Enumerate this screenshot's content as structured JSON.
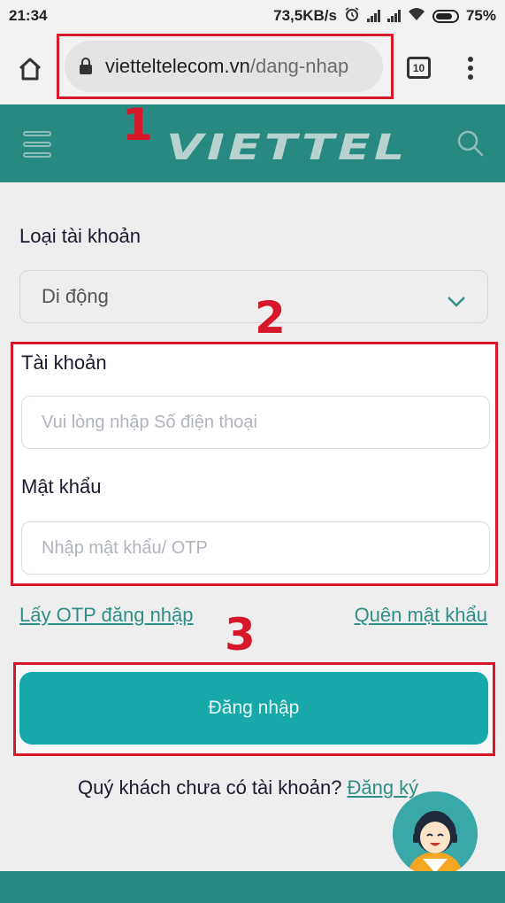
{
  "status_bar": {
    "time": "21:34",
    "network_speed": "73,5KB/s",
    "battery_percent": "75%"
  },
  "browser": {
    "url_host": "vietteltelecom.vn",
    "url_path": "/dang-nhap",
    "tab_count": "10"
  },
  "header": {
    "logo_text": "VIETTEL"
  },
  "annotations": {
    "step1": "1",
    "step2": "2",
    "step3": "3"
  },
  "form": {
    "account_type_label": "Loại tài khoản",
    "account_type_value": "Di động",
    "account_label": "Tài khoản",
    "account_placeholder": "Vui lòng nhập Số điện thoại",
    "password_label": "Mật khẩu",
    "password_placeholder": "Nhập mật khẩu/ OTP",
    "otp_link": "Lấy OTP đăng nhập",
    "forgot_link": "Quên mật khẩu",
    "login_button": "Đăng nhập",
    "register_prompt": "Quý khách chưa có tài khoản?",
    "register_link": "Đăng ký"
  },
  "colors": {
    "brand_teal": "#27897f",
    "button_teal": "#17a9aa",
    "link_teal": "#2f8f86",
    "annotation_red": "#d6182a"
  },
  "icons": [
    "home-icon",
    "lock-icon",
    "tabs-icon",
    "more-vert-icon",
    "hamburger-menu-icon",
    "search-icon",
    "chevron-down-icon",
    "support-avatar-icon"
  ]
}
